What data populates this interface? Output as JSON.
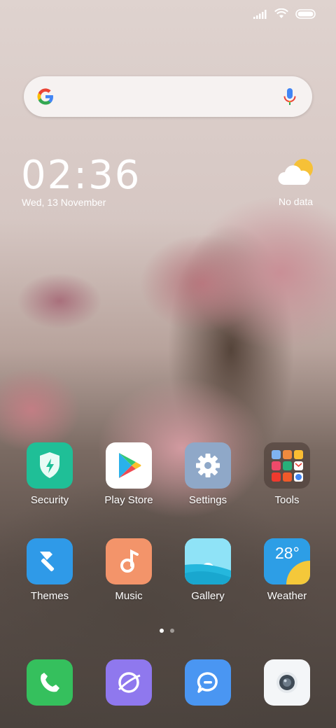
{
  "clock": {
    "time": "02:36",
    "date": "Wed, 13 November"
  },
  "weather_widget": {
    "status": "No data"
  },
  "apps": {
    "security": "Security",
    "play_store": "Play Store",
    "settings": "Settings",
    "tools": "Tools",
    "themes": "Themes",
    "music": "Music",
    "gallery": "Gallery",
    "weather": "Weather",
    "weather_temp": "28°"
  },
  "pager": {
    "current_page": 1,
    "total_pages": 2
  },
  "colors": {
    "security": "#1fbf97",
    "settings": "#8fa8c8",
    "themes": "#2f9ae8",
    "music": "#f3946a",
    "phone": "#35c05d",
    "browser": "#8f78ee",
    "messaging": "#4a96f2"
  }
}
